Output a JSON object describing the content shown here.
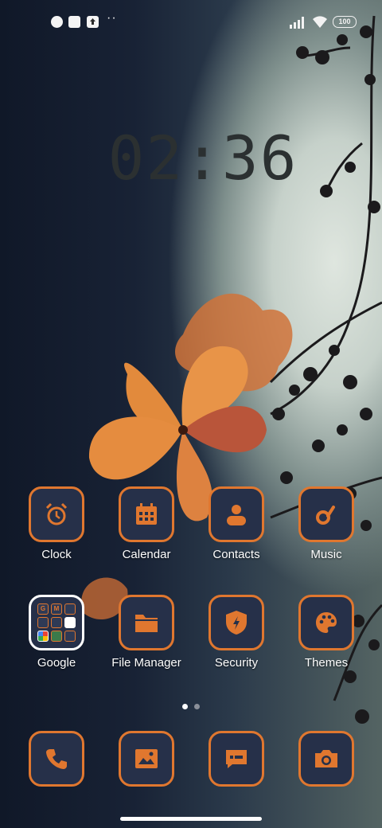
{
  "status_bar": {
    "notification_icons": [
      "app-notification-icon",
      "square-notification-icon",
      "upload-notification-icon"
    ],
    "more_dots": "··",
    "battery": "100"
  },
  "clock": {
    "time": "02:36"
  },
  "apps_row1": [
    {
      "label": "Clock",
      "icon": "alarm-clock-icon"
    },
    {
      "label": "Calendar",
      "icon": "calendar-icon"
    },
    {
      "label": "Contacts",
      "icon": "contact-person-icon"
    },
    {
      "label": "Music",
      "icon": "music-note-icon"
    }
  ],
  "apps_row2": [
    {
      "label": "Google",
      "icon": "google-folder"
    },
    {
      "label": "File Manager",
      "icon": "folder-icon"
    },
    {
      "label": "Security",
      "icon": "shield-bolt-icon"
    },
    {
      "label": "Themes",
      "icon": "palette-icon"
    }
  ],
  "google_folder_items": [
    "G",
    "M",
    "",
    "",
    "",
    "",
    "",
    "",
    ""
  ],
  "dock": [
    "phone-icon",
    "gallery-image-icon",
    "messages-icon",
    "camera-icon"
  ],
  "page_indicator": {
    "pages": 2,
    "current": 1
  },
  "colors": {
    "accent": "#e0772f",
    "tile_bg": "#263049"
  }
}
